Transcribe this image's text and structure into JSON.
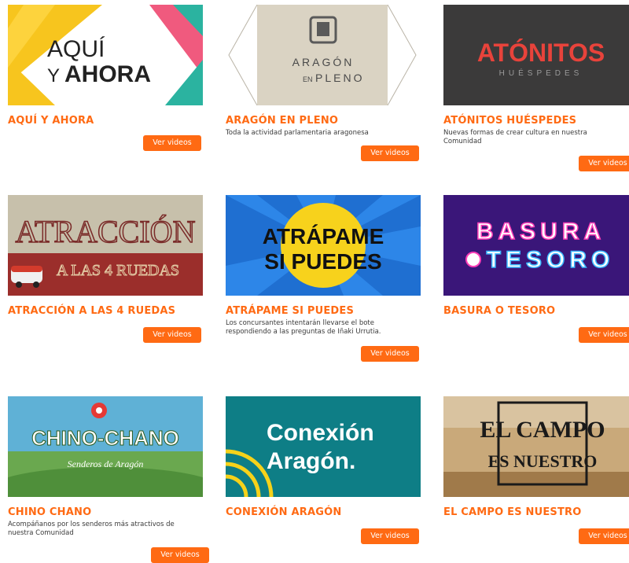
{
  "button_label": "Ver videos",
  "programs": [
    {
      "title": "AQUÍ Y AHORA",
      "description": "",
      "art": {
        "line1": "AQUÍ",
        "line2a": "Y",
        "line2b": "AHORA"
      }
    },
    {
      "title": "ARAGÓN EN PLENO",
      "description": "Toda la actividad parlamentaria aragonesa",
      "art": {
        "line1": "ARAGÓN",
        "line2a": "EN",
        "line2b": "PLENO"
      }
    },
    {
      "title": "ATÓNITOS HUÉSPEDES",
      "description": "Nuevas formas de crear cultura en nuestra Comunidad",
      "art": {
        "line1": "ATÓNITOS",
        "line2": "HUÉSPEDES"
      }
    },
    {
      "title": "ATRACCIÓN A LAS 4 RUEDAS",
      "description": "",
      "art": {
        "line1": "ATRACCIÓN",
        "line2": "A LAS 4 RUEDAS"
      }
    },
    {
      "title": "ATRÁPAME SI PUEDES",
      "description": "Los concursantes intentarán llevarse el bote respondiendo a las preguntas de Iñaki Urrutia.",
      "art": {
        "line1": "ATRÁPAME",
        "line2": "SI PUEDES"
      }
    },
    {
      "title": "BASURA O TESORO",
      "description": "",
      "art": {
        "line1": "BASURA",
        "line2": "TESORO"
      }
    },
    {
      "title": "CHINO CHANO",
      "description": "Acompáñanos por los senderos más atractivos de nuestra Comunidad",
      "art": {
        "line1": "CHINO-CHANO",
        "line2": "Senderos de Aragón"
      }
    },
    {
      "title": "CONEXIÓN ARAGÓN",
      "description": "",
      "art": {
        "line1": "Conexión",
        "line2": "Aragón."
      }
    },
    {
      "title": "EL CAMPO ES NUESTRO",
      "description": "",
      "art": {
        "line1": "EL CAMPO",
        "line2": "ES NUESTRO"
      }
    }
  ]
}
